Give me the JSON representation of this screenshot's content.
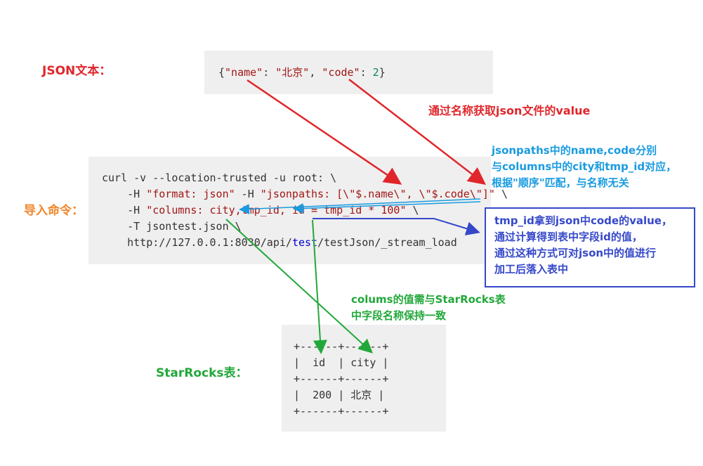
{
  "labels": {
    "json_text": "JSON文本：",
    "import_cmd": "导入命令：",
    "starrocks_table": "StarRocks表："
  },
  "json_sample": {
    "open": "{",
    "key1": "\"name\"",
    "colon1": ": ",
    "val1": "\"北京\"",
    "comma": ", ",
    "key2": "\"code\"",
    "colon2": ": ",
    "val2": "2",
    "close": "}"
  },
  "command": {
    "line1": "curl -v --location-trusted -u root: \\",
    "line2_pre": "    -H ",
    "line2_a": "\"format: json\"",
    "line2_mid": " -H ",
    "line2_b": "\"jsonpaths: [\\\"$.name\\\", \\\"$.code\\\"]\"",
    "line2_end": " \\",
    "line3_pre": "    -H ",
    "line3_a": "\"columns: city,tmp_id, id = tmp_id * 100\"",
    "line3_end": " \\",
    "line4": "    -T jsontest.json \\",
    "line5_pre": "    http://127.0.0.1:8030/api/",
    "line5_kw": "test",
    "line5_post": "/testJson/_stream_load"
  },
  "annotations": {
    "red_note": "通过名称获取json文件的value",
    "cyan_note_l1": "jsonpaths中的name,code分别",
    "cyan_note_l2": "与columns中的city和tmp_id对应，",
    "cyan_note_l3": "根据\"顺序\"匹配，与名称无关",
    "blue_note_l1": "tmp_id拿到json中code的value，",
    "blue_note_l2": "通过计算得到表中字段id的值，",
    "blue_note_l3": "通过这种方式可对json中的值进行",
    "blue_note_l4": "加工后落入表中",
    "green_note_l1": "colums的值需与StarRocks表",
    "green_note_l2": "中字段名称保持一致"
  },
  "result_table": {
    "border": "+------+------+",
    "header": "|  id  | city |",
    "row": "|  200 | 北京 |"
  },
  "colors": {
    "red": "#e0262b",
    "orange": "#f0862a",
    "green": "#22a83a",
    "cyan": "#1a9be0",
    "blue": "#3548c9"
  }
}
